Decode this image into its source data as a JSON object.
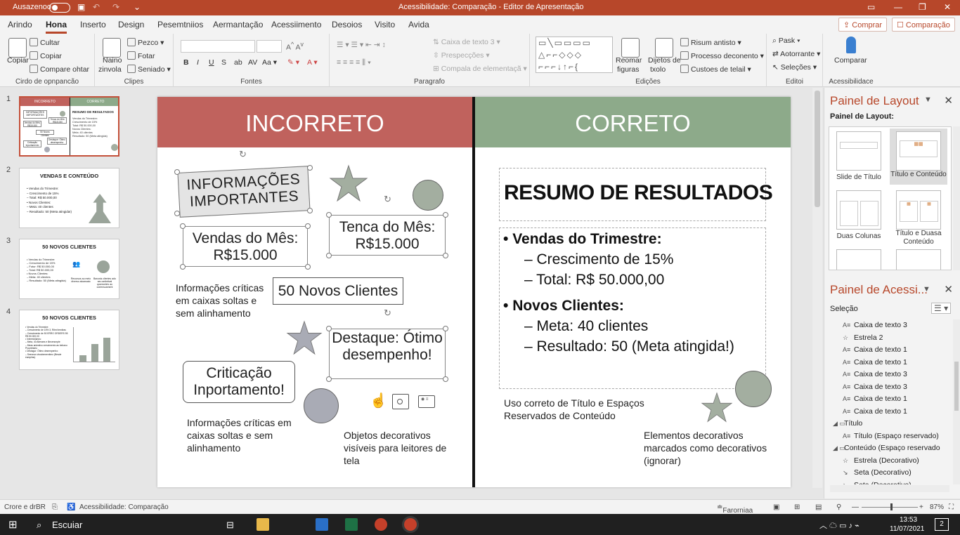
{
  "window": {
    "autosave": "Ausazenoo",
    "title": "Acessibilidade: Comparação - Editor de Apresentação"
  },
  "tabs": [
    "Arindo",
    "Hona",
    "Inserto",
    "Design",
    "Pesemtniios",
    "Aermantação",
    "Acessiimento",
    "Desoios",
    "Visito",
    "Avida"
  ],
  "tab_buttons": {
    "comprar": "Comprar",
    "comparacao": "Comparação"
  },
  "ribbon": {
    "clip": {
      "copiar": "Copiar",
      "cultar": "Cultar",
      "copiar2": "Copiar",
      "compare": "Compare ohtar",
      "label": "Cirdo de opnpancão"
    },
    "clipes": {
      "naino": "Naino",
      "zinvola": "zinvola",
      "pezco": "Pezco",
      "fotar": "Fotar",
      "seniado": "Seniado",
      "label": "Clipes"
    },
    "fontes": {
      "label": "Fontes"
    },
    "paragrafo": {
      "caixa": "Caixa de texto 3",
      "prespecoes": "Prespecções",
      "compala": "Compala de elementaçã",
      "label": "Paragrafo"
    },
    "edicoes": {
      "reomar": "Reomar",
      "reomar2": "figuras",
      "dijetos": "Dijetos de",
      "txolo": "txolo",
      "risum": "Risum antisto",
      "processo": "Processo deconento",
      "custoes": "Custoes de telail",
      "label": "Edições"
    },
    "editor": {
      "pask": "Pask",
      "autorrante": "Aotorrante",
      "selecoes": "Seleções",
      "label": "Editoi"
    },
    "acc": {
      "comparar": "Comparar",
      "label": "Acessibilidace"
    }
  },
  "thumbs": [
    {
      "n": "1",
      "lines": [
        "INCORRETO",
        "CORRETO",
        "RESUMO DE RESULTADOS",
        "Vendas do Trimestre:",
        "Crescimento de 15%",
        "Total: R$ 50.000,00",
        "Novos Clientes:",
        "Meta: 40 clientes",
        "Resultado: 50 (Meta atingida)",
        "INFORMAÇÕES IMPORTANTES",
        "Vendas do Mês: R$15.000",
        "Tenca do Mês: R$15.000",
        "50 Novos Clientes",
        "Destaque: Ótimo desempenho",
        "Criticação Inportamento"
      ]
    },
    {
      "n": "2",
      "title": "VENDAS E CONTEÚDO",
      "lines": [
        "• Vendas do Trimestre:",
        "   – Crescimento de 15%",
        "   – Total: R$ 50.000,00",
        "• Novos Clientes:",
        "   – Meta: 40 clientes",
        "   – Resultado: 50 (Meta atingida!)"
      ]
    },
    {
      "n": "3",
      "title": "50 NOVOS CLIENTES",
      "lines": [
        "• Vendas do Trimestre:",
        "   – Crescimento de 15%",
        "   – Futur: R$ 50.000,00",
        "   – Total: R$ 50.000,00",
        "• Novos Clientes:",
        "   – Meta: 40 clientes",
        "   – Resultado: 50 (Meta atingida)"
      ],
      "cols": [
        "Recursos ao meio diverso alcansato",
        "Bavosis clientes ado seu antintival qusmontes ao coeenscament"
      ]
    },
    {
      "n": "4",
      "title": "50 NOVOS CLIENTES",
      "lines": [
        "• Vendas do Trimestre:",
        "   – Crescimento de 15% 3, Ritmi temiiras",
        "   – Crescimento de 50 ERRO ORDERS 55 R$ 50.000,00",
        "• Intermidiarios:",
        "   – Meta, 40 Alteraes e illecersmpte",
        "   – Meas aniestivo crescimento as behanu Proprietario",
        "• Destagur: Ótimo desempenho:",
        "   – Seennus vbusbmeentimo (Besde eamplias)"
      ],
      "bars": [
        20,
        55,
        75
      ]
    }
  ],
  "slide": {
    "left_header": "INCORRETO",
    "right_header": "CORRETO",
    "colors": {
      "left": "#c0625d",
      "right": "#8daa8a",
      "shape": "#a3aea0",
      "circle2": "#a9abb5"
    },
    "info_title": "INFORMAÇÕES IMPORTANTES",
    "vendas": "Vendas do Mês: R$15.000",
    "tenca": "Tenca do Mês: R$15.000",
    "novos": "50 Novos Clientes",
    "destaque": "Destaque: Ótimo desempenho!",
    "criticacao": "Criticação Inportamento!",
    "cap1": "Informações críticas em caixas soltas e sem alinhamento",
    "cap2": "Informações críticas em caixas soltas e sem alinhamento",
    "cap3": "Objetos decorativos visíveis para leitores de tela",
    "resumo": "RESUMO DE RESULTADOS",
    "b1": "Vendas do Trimestre:",
    "b1a": "– Crescimento de 15%",
    "b1b": "– Total: R$ 50.000,00",
    "b2": "Novos Clientes:",
    "b2a": "– Meta: 40 clientes",
    "b2b": "– Resultado: 50 (Meta atingida!)",
    "cap4": "Uso correto de Título e Espaços Reservados de Conteúdo",
    "cap5": "Elementos decorativos marcados como decorativos (ignorar)"
  },
  "layout_pane": {
    "title": "Painel de Layout",
    "subtitle": "Painel de Layout:",
    "items": [
      "Slide de Título",
      "Título e Conteúdo",
      "Duas Colunas",
      "Título e Duasa Conteúdo"
    ]
  },
  "acc_pane": {
    "title": "Painel de Acessi...",
    "selection": "Seleção",
    "items": [
      "Caixa de texto 3",
      "Estrela 2",
      "Caixa de texto 1",
      "Caixa de texto 1",
      "Caixa de texto 3",
      "Caixa de texto 3",
      "Caixa de texto 1",
      "Caixa de texto 1",
      "Título",
      "Título (Espaço reservado)",
      "Conteúdo (Espaço reservado",
      "Estrela (Decorativo)",
      "Seta (Decorativo)",
      "Seta (Decorativo)"
    ]
  },
  "status": {
    "left": "Crore e drBR",
    "acc": "Acessibilidade: Comparação",
    "notes": "Farorniaa",
    "zoom": "87%"
  },
  "taskbar": {
    "search": "Escuiar",
    "time": "13:53",
    "date": "11/07/2021",
    "badge": "2"
  }
}
